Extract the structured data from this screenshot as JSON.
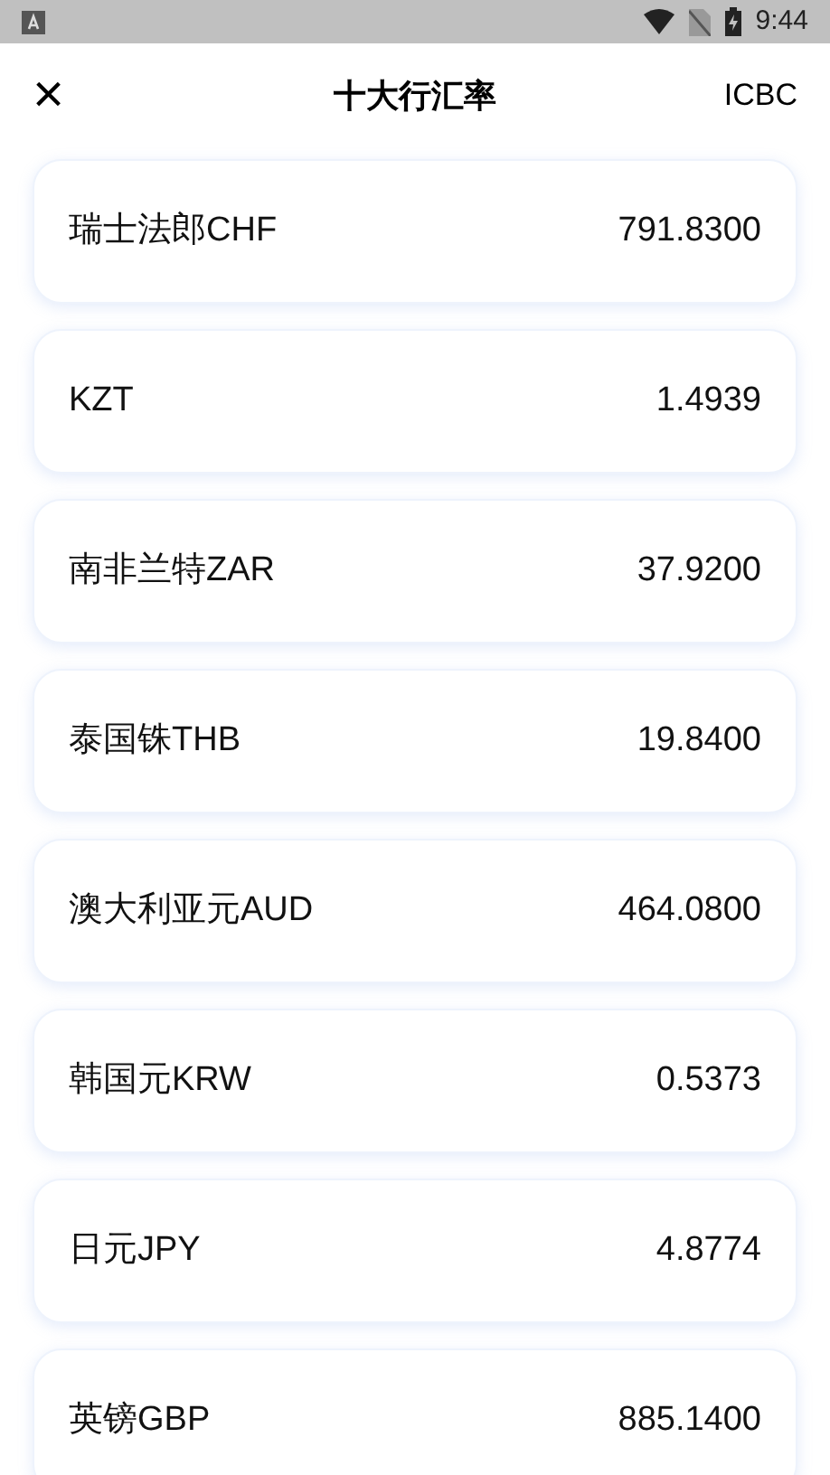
{
  "status_bar": {
    "time": "9:44"
  },
  "header": {
    "close": "×",
    "title": "十大行汇率",
    "bank": "ICBC"
  },
  "rates": [
    {
      "name": "瑞士法郎CHF",
      "value": "791.8300"
    },
    {
      "name": "KZT",
      "value": "1.4939"
    },
    {
      "name": "南非兰特ZAR",
      "value": "37.9200"
    },
    {
      "name": "泰国铢THB",
      "value": "19.8400"
    },
    {
      "name": "澳大利亚元AUD",
      "value": "464.0800"
    },
    {
      "name": "韩国元KRW",
      "value": "0.5373"
    },
    {
      "name": "日元JPY",
      "value": "4.8774"
    },
    {
      "name": "英镑GBP",
      "value": "885.1400"
    }
  ]
}
